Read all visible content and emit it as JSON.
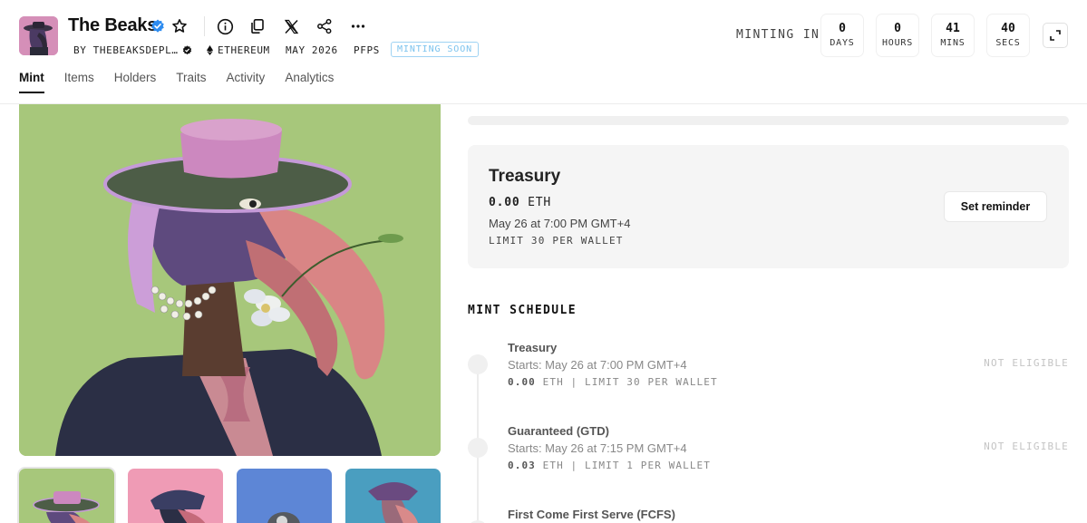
{
  "header": {
    "title": "The Beaks",
    "creator": "BY THEBEAKSDEPL…",
    "chain": "ETHEREUM",
    "date": "MAY 2026",
    "category": "PFPS",
    "badge": "MINTING SOON"
  },
  "tabs": [
    {
      "label": "Mint",
      "active": true
    },
    {
      "label": "Items"
    },
    {
      "label": "Holders"
    },
    {
      "label": "Traits"
    },
    {
      "label": "Activity"
    },
    {
      "label": "Analytics"
    }
  ],
  "countdown": {
    "label": "MINTING IN",
    "units": [
      {
        "value": "0",
        "unit": "DAYS"
      },
      {
        "value": "0",
        "unit": "HOURS"
      },
      {
        "value": "41",
        "unit": "MINS"
      },
      {
        "value": "40",
        "unit": "SECS"
      }
    ]
  },
  "current_stage": {
    "title": "Treasury",
    "price": "0.00",
    "currency": "ETH",
    "date": "May 26 at 7:00 PM GMT+4",
    "limit": "LIMIT 30 PER WALLET",
    "button": "Set reminder"
  },
  "schedule": {
    "title": "MINT SCHEDULE",
    "stages": [
      {
        "name": "Treasury",
        "start": "Starts: May 26 at 7:00 PM GMT+4",
        "price": "0.00",
        "currency": "ETH",
        "limit": "| LIMIT 30 PER WALLET",
        "status": "NOT ELIGIBLE"
      },
      {
        "name": "Guaranteed (GTD)",
        "start": "Starts: May 26 at 7:15 PM GMT+4",
        "price": "0.03",
        "currency": "ETH",
        "limit": "| LIMIT 1 PER WALLET",
        "status": "NOT ELIGIBLE"
      },
      {
        "name": "First Come First Serve (FCFS)"
      }
    ]
  },
  "colors": {
    "hero_bg": "#a7c77b",
    "thumb_bgs": [
      "#a7c77b",
      "#ef9bb5",
      "#5d86d6",
      "#4a9ec0"
    ],
    "verified": "#2d8cf0",
    "badge": "#7cc3ee"
  }
}
